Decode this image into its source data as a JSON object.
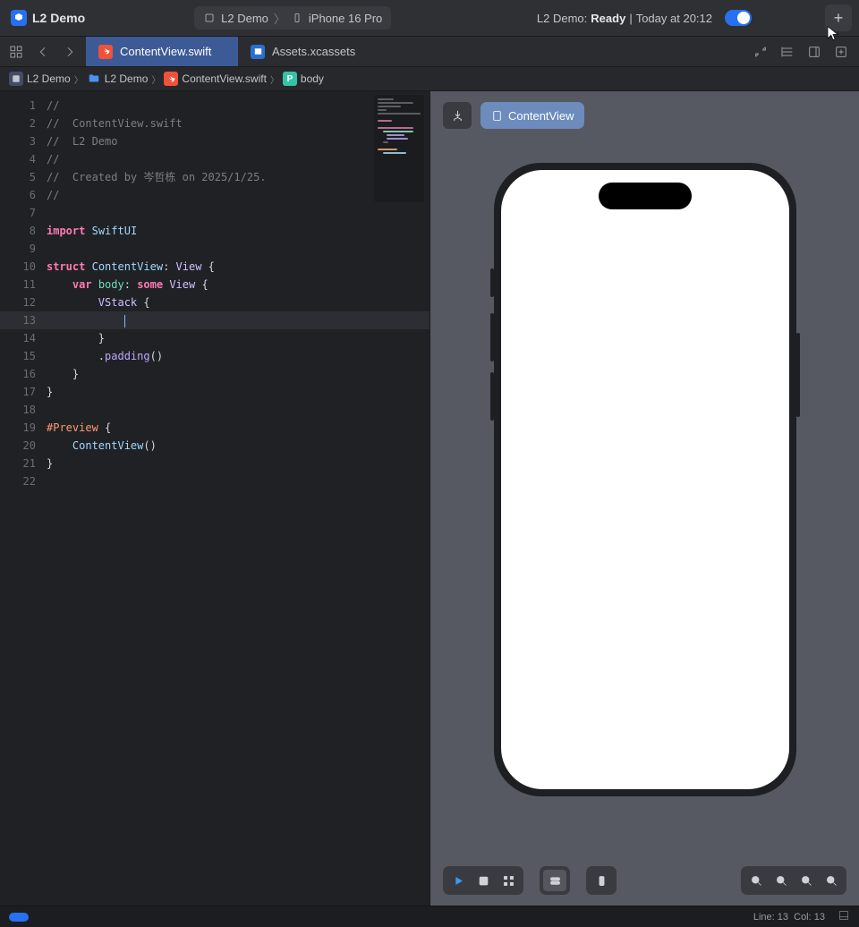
{
  "titlebar": {
    "project": "L2 Demo",
    "scheme": "L2 Demo",
    "device": "iPhone 16 Pro",
    "status_prefix": "L2 Demo: ",
    "status_state": "Ready",
    "status_sep": " | ",
    "status_time": "Today at 20:12"
  },
  "tabs": [
    {
      "label": "ContentView.swift",
      "active": true,
      "type": "swift"
    },
    {
      "label": "Assets.xcassets",
      "active": false,
      "type": "assets"
    }
  ],
  "breadcrumb": {
    "items": [
      "L2 Demo",
      "L2 Demo",
      "ContentView.swift",
      "body"
    ]
  },
  "editor": {
    "cursor_line": 13,
    "cursor_col": 13,
    "lines": [
      {
        "n": 1,
        "segs": [
          {
            "t": "//",
            "c": "comment"
          }
        ]
      },
      {
        "n": 2,
        "segs": [
          {
            "t": "//  ContentView.swift",
            "c": "comment"
          }
        ]
      },
      {
        "n": 3,
        "segs": [
          {
            "t": "//  L2 Demo",
            "c": "comment"
          }
        ]
      },
      {
        "n": 4,
        "segs": [
          {
            "t": "//",
            "c": "comment"
          }
        ]
      },
      {
        "n": 5,
        "segs": [
          {
            "t": "//  Created by 岑哲栋 on 2025/1/25.",
            "c": "comment"
          }
        ]
      },
      {
        "n": 6,
        "segs": [
          {
            "t": "//",
            "c": "comment"
          }
        ]
      },
      {
        "n": 7,
        "segs": []
      },
      {
        "n": 8,
        "segs": [
          {
            "t": "import",
            "c": "key"
          },
          {
            "t": " "
          },
          {
            "t": "SwiftUI",
            "c": "type"
          }
        ]
      },
      {
        "n": 9,
        "segs": []
      },
      {
        "n": 10,
        "segs": [
          {
            "t": "struct",
            "c": "key"
          },
          {
            "t": " "
          },
          {
            "t": "ContentView",
            "c": "type"
          },
          {
            "t": ": "
          },
          {
            "t": "View",
            "c": "typesys"
          },
          {
            "t": " {"
          }
        ]
      },
      {
        "n": 11,
        "segs": [
          {
            "t": "    "
          },
          {
            "t": "var",
            "c": "key"
          },
          {
            "t": " "
          },
          {
            "t": "body",
            "c": "attr"
          },
          {
            "t": ": "
          },
          {
            "t": "some",
            "c": "key"
          },
          {
            "t": " "
          },
          {
            "t": "View",
            "c": "typesys"
          },
          {
            "t": " {"
          }
        ]
      },
      {
        "n": 12,
        "segs": [
          {
            "t": "        "
          },
          {
            "t": "VStack",
            "c": "typesys"
          },
          {
            "t": " {"
          }
        ]
      },
      {
        "n": 13,
        "segs": [
          {
            "t": "            "
          },
          {
            "caret": true
          }
        ]
      },
      {
        "n": 14,
        "segs": [
          {
            "t": "        }"
          }
        ]
      },
      {
        "n": 15,
        "segs": [
          {
            "t": "        ."
          },
          {
            "t": "padding",
            "c": "func"
          },
          {
            "t": "()"
          }
        ]
      },
      {
        "n": 16,
        "segs": [
          {
            "t": "    }"
          }
        ]
      },
      {
        "n": 17,
        "segs": [
          {
            "t": "}"
          }
        ]
      },
      {
        "n": 18,
        "segs": []
      },
      {
        "n": 19,
        "segs": [
          {
            "t": "#Preview",
            "c": "preview"
          },
          {
            "t": " {"
          }
        ]
      },
      {
        "n": 20,
        "segs": [
          {
            "t": "    "
          },
          {
            "t": "ContentView",
            "c": "type"
          },
          {
            "t": "()"
          }
        ]
      },
      {
        "n": 21,
        "segs": [
          {
            "t": "}"
          }
        ]
      },
      {
        "n": 22,
        "segs": []
      }
    ]
  },
  "preview": {
    "label": "ContentView"
  },
  "statusbar": {
    "line_label": "Line:",
    "col_label": "Col:",
    "line": 13,
    "col": 13
  }
}
